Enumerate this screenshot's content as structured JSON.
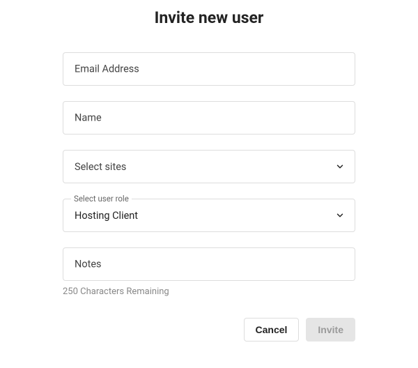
{
  "title": "Invite new user",
  "fields": {
    "email": {
      "label": "Email Address",
      "value": ""
    },
    "name": {
      "label": "Name",
      "value": ""
    },
    "sites": {
      "placeholder": "Select sites"
    },
    "role": {
      "label": "Select user role",
      "value": "Hosting Client"
    },
    "notes": {
      "label": "Notes",
      "value": ""
    }
  },
  "helper": {
    "chars_remaining": "250 Characters Remaining"
  },
  "actions": {
    "cancel": "Cancel",
    "invite": "Invite"
  }
}
